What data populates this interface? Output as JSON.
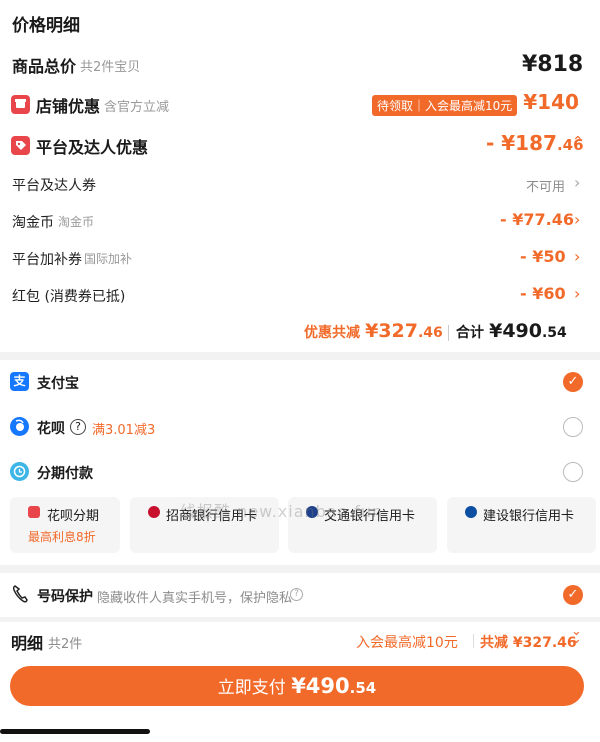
{
  "header": {
    "title": "价格明细"
  },
  "price_detail": {
    "total_label": "商品总价",
    "total_count": "共2件宝贝",
    "total_value": "¥818",
    "shop_label": "店铺优惠",
    "shop_sub": "含官方立减",
    "shop_tag": "待领取｜入会最高减10元",
    "shop_value": "- ¥140",
    "platform_label": "平台及达人优惠",
    "platform_value_int": "- ¥187",
    "platform_value_dec": ".46",
    "rows": [
      {
        "label": "平台及达人券",
        "sub": "",
        "value": "不可用"
      },
      {
        "label": "淘金币",
        "sub": "淘金币",
        "value": "- ¥77.46"
      },
      {
        "label": "平台加补券",
        "sub": "国际加补",
        "value": "- ¥50"
      },
      {
        "label": "红包 (消费券已抵)",
        "sub": "",
        "value": "- ¥60"
      }
    ],
    "discount_label": "优惠共减",
    "discount_int": "¥327",
    "discount_dec": ".46",
    "sum_label": "合计",
    "sum_int": "¥490",
    "sum_dec": ".54"
  },
  "payment": {
    "alipay_label": "支付宝",
    "huabei_label": "花呗",
    "huabei_promo": "满3.01减3",
    "installment_label": "分期付款",
    "banks": [
      {
        "name": "花呗分期",
        "sub": "最高利息8折"
      },
      {
        "name": "招商银行信用卡",
        "sub": ""
      },
      {
        "name": "交通银行信用卡",
        "sub": ""
      },
      {
        "name": "建设银行信用卡",
        "sub": ""
      }
    ],
    "selected": "支付宝"
  },
  "privacy": {
    "label": "号码保护",
    "desc": "隐藏收件人真实手机号，保护隐私"
  },
  "footer": {
    "detail_label": "明细",
    "detail_count": "共2件",
    "promo": "入会最高减10元",
    "total_reduce": "共减 ¥327.46",
    "pay_label": "立即支付",
    "pay_int": "¥490",
    "pay_dec": ".54"
  },
  "watermark": "线报酷 new.xianbao.fun",
  "colors": {
    "accent": "#f26a2a",
    "background": "#f2f2f2"
  }
}
